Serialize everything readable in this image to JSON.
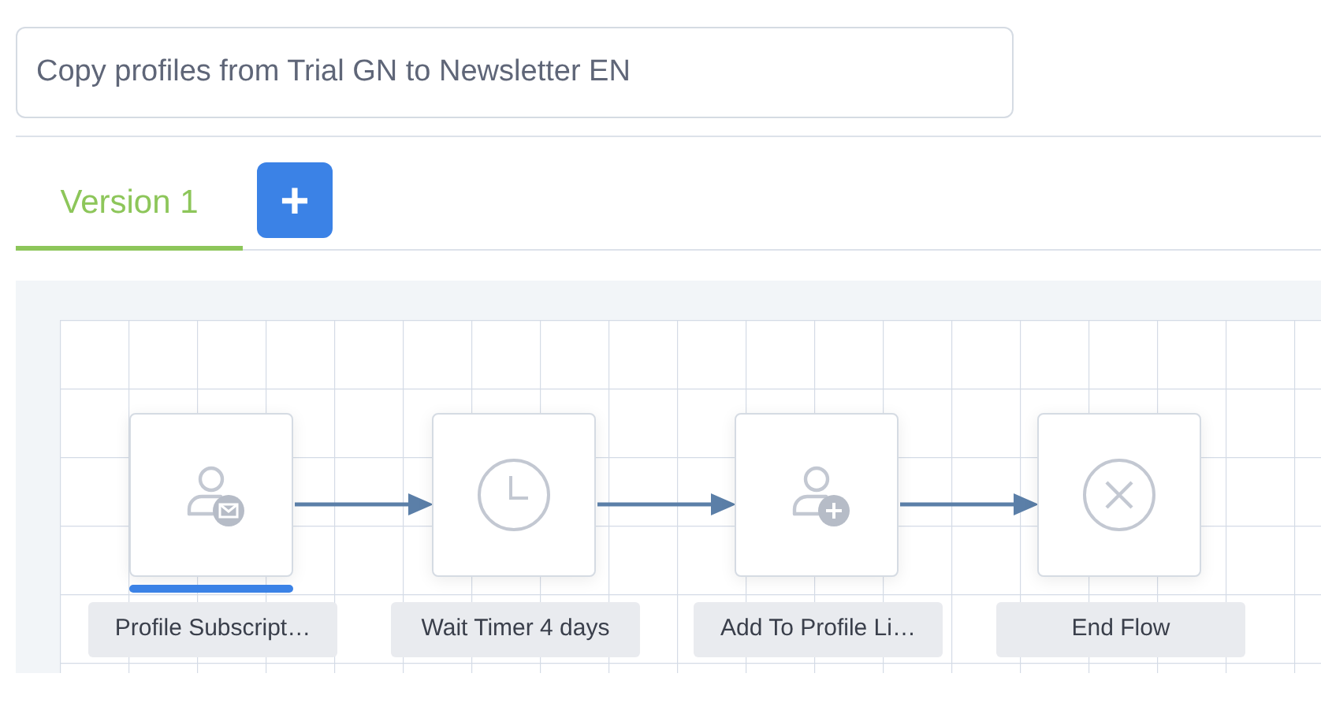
{
  "flow_name": {
    "value": "Copy profiles from Trial GN to Newsletter EN"
  },
  "tabs": [
    {
      "label": "Version 1",
      "selected": true
    }
  ],
  "add_version_button": {
    "label": "+"
  },
  "nodes": [
    {
      "kind": "profile_subscription",
      "label": "Profile Subscript…",
      "selected": true
    },
    {
      "kind": "wait_timer",
      "label": "Wait Timer 4 days",
      "selected": false
    },
    {
      "kind": "add_to_list",
      "label": "Add To Profile Li…",
      "selected": false
    },
    {
      "kind": "end_flow",
      "label": "End Flow",
      "selected": false
    }
  ]
}
